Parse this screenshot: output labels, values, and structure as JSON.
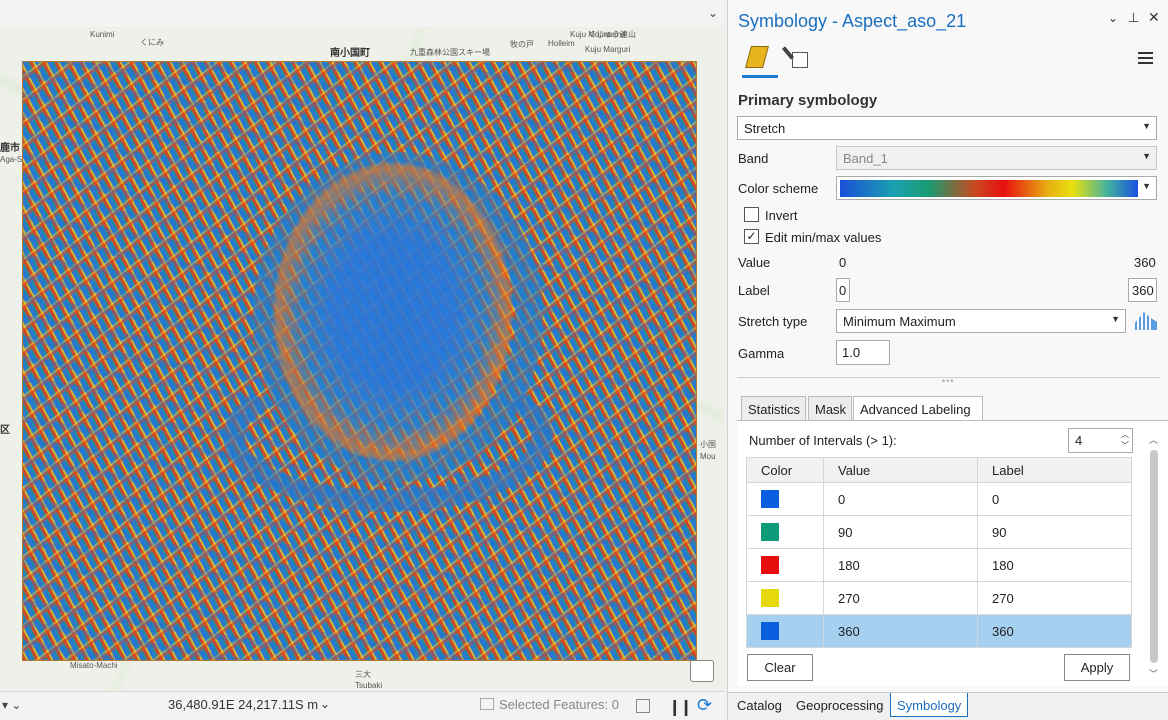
{
  "map": {
    "place_labels": [
      "Kunimi",
      "くにみ",
      "南小国町",
      "九重森林公園スキー場",
      "牧の戸",
      "Holleim",
      "Kuju Marguri",
      "くじゅう連山",
      "Kuju Mountains",
      "鹿市",
      "Misato-Machi",
      "三大",
      "Tsubaki",
      "Aga-Shi",
      "区",
      "Mou",
      "小国"
    ],
    "status": {
      "coordinates": "36,480.91E 24,217.11S m",
      "selected_features": "Selected Features: 0"
    }
  },
  "pane": {
    "title": "Symbology - Aspect_aso_21",
    "primary_heading": "Primary symbology",
    "renderer": "Stretch",
    "band_label": "Band",
    "band_value": "Band_1",
    "color_scheme_label": "Color scheme",
    "invert_label": "Invert",
    "invert_checked": false,
    "edit_minmax_label": "Edit min/max values",
    "edit_minmax_checked": true,
    "value_label": "Value",
    "value_min": "0",
    "value_max": "360",
    "label_label": "Label",
    "label_min": "0",
    "label_max": "360",
    "stretch_type_label": "Stretch type",
    "stretch_type_value": "Minimum Maximum",
    "gamma_label": "Gamma",
    "gamma_value": "1.0",
    "tabs": {
      "statistics": "Statistics",
      "mask": "Mask",
      "advanced_labeling": "Advanced Labeling"
    },
    "intervals_label": "Number of Intervals (> 1):",
    "intervals_value": "4",
    "table": {
      "headers": [
        "Color",
        "Value",
        "Label"
      ],
      "rows": [
        {
          "color": "#0a5fe0",
          "value": "0",
          "label": "0"
        },
        {
          "color": "#0f9a7a",
          "value": "90",
          "label": "90"
        },
        {
          "color": "#e50d0d",
          "value": "180",
          "label": "180"
        },
        {
          "color": "#e6d80c",
          "value": "270",
          "label": "270"
        },
        {
          "color": "#0a5fe0",
          "value": "360",
          "label": "360"
        }
      ]
    },
    "clear_label": "Clear",
    "apply_label": "Apply"
  },
  "bottom_tabs": {
    "catalog": "Catalog",
    "geoprocessing": "Geoprocessing",
    "symbology": "Symbology"
  },
  "icons": [
    "chevron-down-icon",
    "pin-icon",
    "close-icon",
    "paintbrush-icon",
    "label-class-icon",
    "hamburger-menu-icon",
    "histogram-icon",
    "pause-icon",
    "refresh-icon",
    "table-icon",
    "select-features-icon"
  ]
}
